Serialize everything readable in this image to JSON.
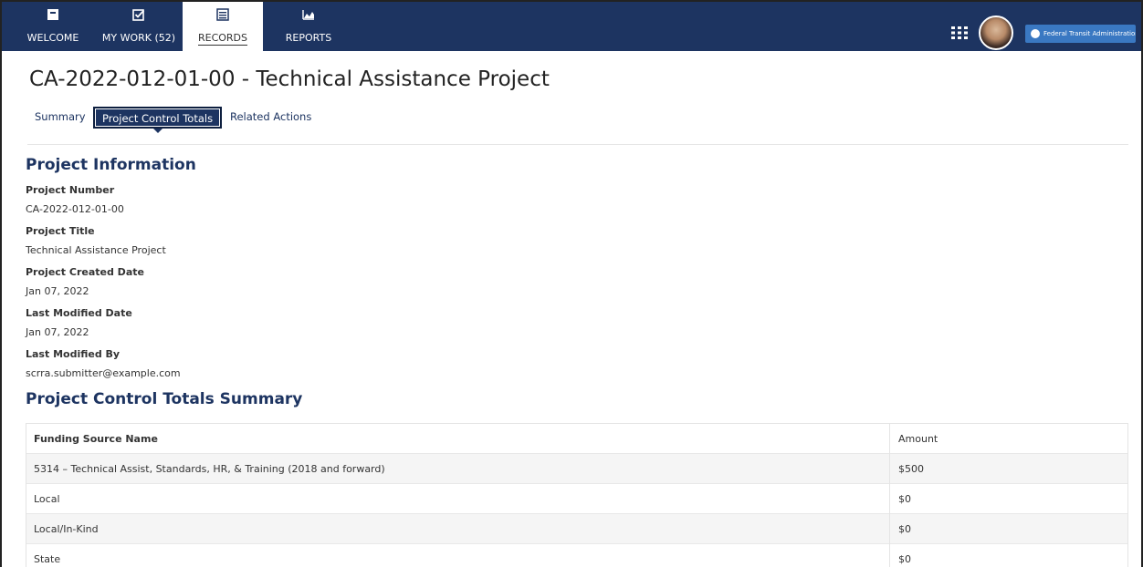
{
  "nav": {
    "tabs": [
      {
        "label": "WELCOME",
        "icon": "inbox-icon"
      },
      {
        "label": "MY WORK (52)",
        "icon": "checkbox-icon"
      },
      {
        "label": "RECORDS",
        "icon": "records-icon"
      },
      {
        "label": "REPORTS",
        "icon": "chart-icon"
      }
    ],
    "active_tab": "RECORDS",
    "agency_label": "Federal Transit Administration",
    "colors": {
      "bar": "#1d3461",
      "badge": "#3a78c2"
    }
  },
  "page": {
    "title": "CA-2022-012-01-00 - Technical Assistance Project",
    "tabs": [
      {
        "label": "Summary"
      },
      {
        "label": "Project Control Totals"
      },
      {
        "label": "Related Actions"
      }
    ],
    "active_tab": "Project Control Totals"
  },
  "project_info": {
    "heading": "Project Information",
    "fields": [
      {
        "label": "Project Number",
        "value": "CA-2022-012-01-00"
      },
      {
        "label": "Project Title",
        "value": "Technical Assistance Project"
      },
      {
        "label": "Project Created Date",
        "value": "Jan 07, 2022"
      },
      {
        "label": "Last Modified Date",
        "value": "Jan 07, 2022"
      },
      {
        "label": "Last Modified By",
        "value": "scrra.submitter@example.com"
      }
    ]
  },
  "totals": {
    "heading": "Project Control Totals Summary",
    "columns": [
      "Funding Source Name",
      "Amount"
    ],
    "rows": [
      {
        "name": "5314 – Technical Assist, Standards, HR, & Training (2018 and forward)",
        "amount": "$500"
      },
      {
        "name": "Local",
        "amount": "$0"
      },
      {
        "name": "Local/In-Kind",
        "amount": "$0"
      },
      {
        "name": "State",
        "amount": "$0"
      }
    ]
  }
}
